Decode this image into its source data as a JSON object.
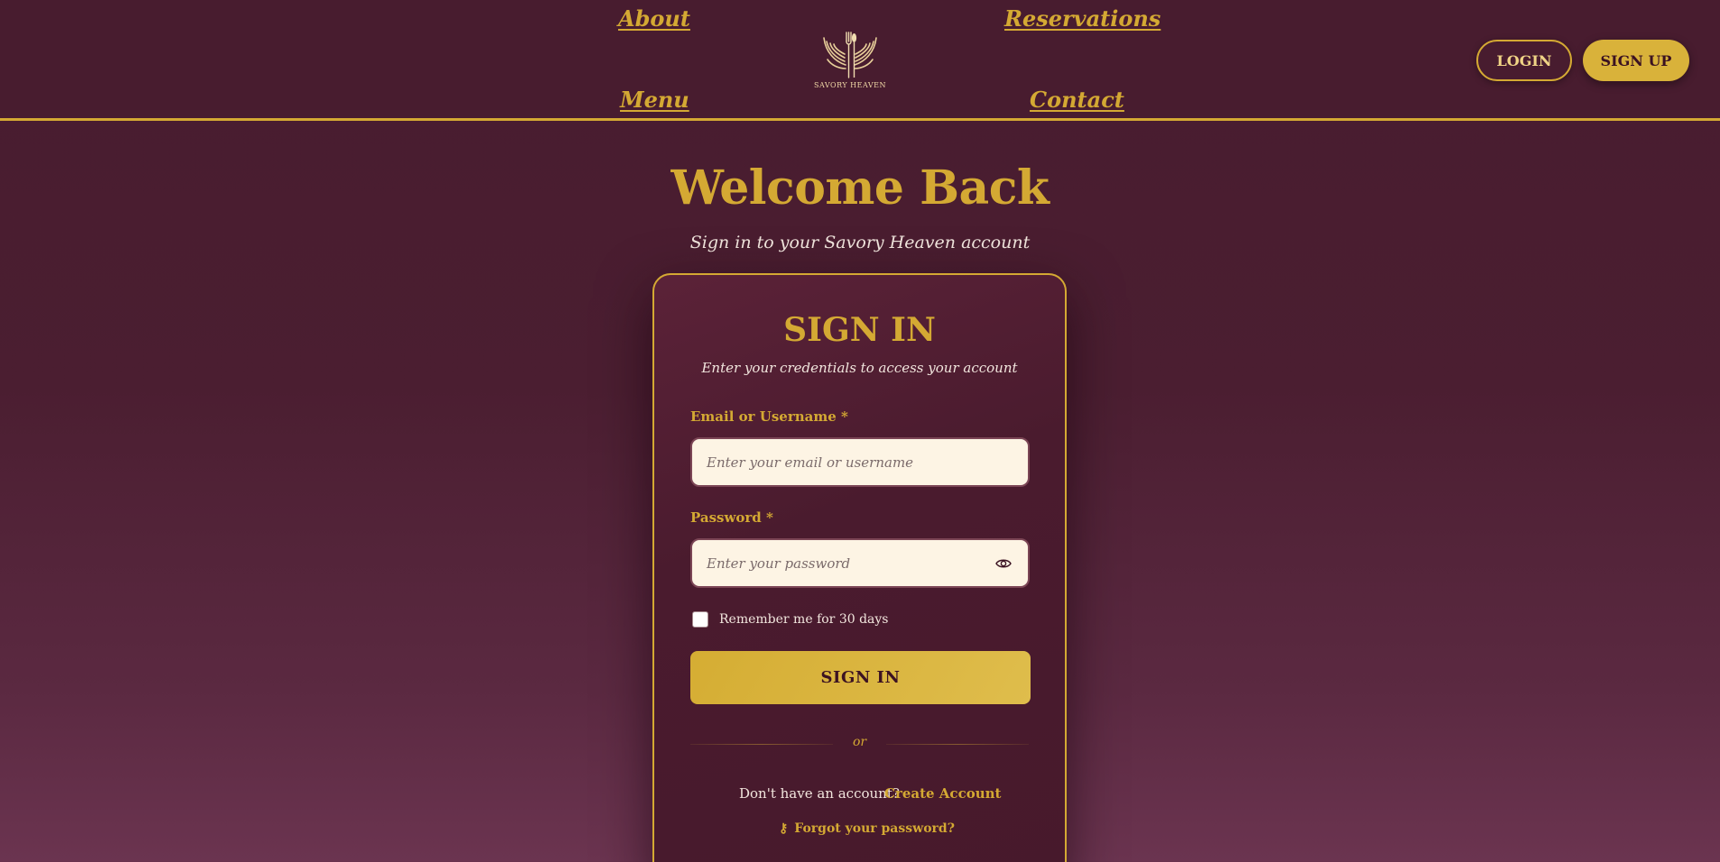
{
  "nav": {
    "about": "About",
    "reservations": "Reservations",
    "menu": "Menu",
    "contact": "Contact"
  },
  "brand": {
    "name": "SAVORY HEAVEN",
    "icon": "winged-fork-spoon-logo"
  },
  "auth_buttons": {
    "login": "LOGIN",
    "signup": "SIGN UP"
  },
  "hero": {
    "title": "Welcome Back",
    "subtitle": "Sign in to your Savory Heaven account"
  },
  "form": {
    "title": "SIGN IN",
    "subtitle": "Enter your credentials to access your account",
    "email": {
      "label": "Email or Username *",
      "value": "",
      "placeholder": "Enter your email or username"
    },
    "password": {
      "label": "Password *",
      "value": "",
      "placeholder": "Enter your password",
      "toggle_icon": "eye-icon"
    },
    "remember": {
      "label": "Remember me for 30 days",
      "checked": false
    },
    "submit": "SIGN IN",
    "divider": "or",
    "no_account": "Don't have an account?",
    "create_account": "Create Account",
    "forgot": "Forgot your password?",
    "forgot_icon": "key-icon"
  },
  "colors": {
    "background": "#481c2f",
    "accent_gold": "#d4a933",
    "input_bg": "#fdf4e4",
    "text_light": "#f2e6de"
  }
}
